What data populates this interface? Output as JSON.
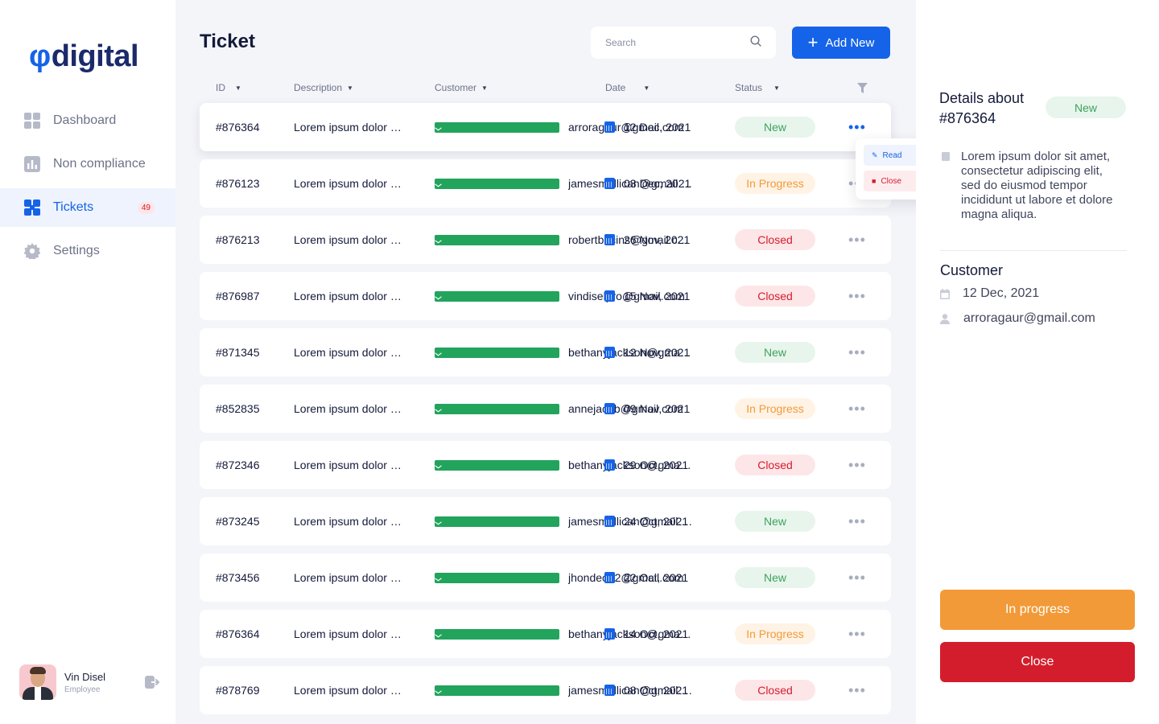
{
  "brand": {
    "mark": "φ",
    "name": "digital"
  },
  "nav": [
    {
      "label": "Dashboard",
      "icon": "dashboard-icon",
      "active": false,
      "badge": ""
    },
    {
      "label": "Non compliance",
      "icon": "chart-icon",
      "active": false,
      "badge": ""
    },
    {
      "label": "Tickets",
      "icon": "tickets-icon",
      "active": true,
      "badge": "49"
    },
    {
      "label": "Settings",
      "icon": "gear-icon",
      "active": false,
      "badge": ""
    }
  ],
  "user": {
    "name": "Vin Disel",
    "role": "Employee"
  },
  "page": {
    "title": "Ticket"
  },
  "search": {
    "placeholder": "Search"
  },
  "actions": {
    "add_label": "Add New"
  },
  "columns": {
    "id": "ID",
    "description": "Description",
    "customer": "Customer",
    "date": "Date",
    "status": "Status"
  },
  "status_colors": {
    "New": {
      "bg": "#e8f5ec",
      "fg": "#3ea35c"
    },
    "In Progress": {
      "bg": "#fff3e6",
      "fg": "#f29a38"
    },
    "Closed": {
      "bg": "#fde6e8",
      "fg": "#d61c2b"
    }
  },
  "tickets": [
    {
      "id": "#876364",
      "description": "Lorem ipsum dolor sit amet",
      "customer": "arroragaur@gmail.com",
      "date": "12 Dec, 2021",
      "status": "New"
    },
    {
      "id": "#876123",
      "description": "Lorem ipsum dolor sit amet",
      "customer": "jamesmullican@gmail.com",
      "date": "03 Dec, 2021",
      "status": "In Progress"
    },
    {
      "id": "#876213",
      "description": "Lorem ipsum dolor sit amet",
      "customer": "robertbacins@gmail.com",
      "date": "26 Nov, 2021",
      "status": "Closed"
    },
    {
      "id": "#876987",
      "description": "Lorem ipsum dolor sit amet",
      "customer": "vindiselpro@gmail.com",
      "date": "15 Nov, 2021",
      "status": "Closed"
    },
    {
      "id": "#871345",
      "description": "Lorem ipsum dolor sit amet",
      "customer": "bethanyjackson@gmail.com",
      "date": "12 Nov, 2021",
      "status": "New"
    },
    {
      "id": "#852835",
      "description": "Lorem ipsum dolor sit amet",
      "customer": "annejacob@gmail.com",
      "date": "09 Nov, 2021",
      "status": "In Progress"
    },
    {
      "id": "#872346",
      "description": "Lorem ipsum dolor sit amet",
      "customer": "bethanyjackson@gmail.com",
      "date": "29 Oct, 2021",
      "status": "Closed"
    },
    {
      "id": "#873245",
      "description": "Lorem ipsum dolor sit amet",
      "customer": "jamesmullican@gmail.com",
      "date": "24 Oct, 2021",
      "status": "New"
    },
    {
      "id": "#873456",
      "description": "Lorem ipsum dolor sit amet",
      "customer": "jhondeo32@gmail.com",
      "date": "22 Oct, 2021",
      "status": "New"
    },
    {
      "id": "#876364",
      "description": "Lorem ipsum dolor sit amet",
      "customer": "bethanyjackson@gmail.com",
      "date": "14 Oct, 2021",
      "status": "In Progress"
    },
    {
      "id": "#878769",
      "description": "Lorem ipsum dolor sit amet",
      "customer": "jamesmullican@gmail.com",
      "date": "08 Oct, 2021",
      "status": "Closed"
    }
  ],
  "row_menu": {
    "read_label": "Read",
    "close_label": "Close"
  },
  "details": {
    "heading": "Details about",
    "ticket_id": "#876364",
    "status": "New",
    "description": "Lorem ipsum dolor sit amet, consectetur adipiscing elit, sed do eiusmod tempor incididunt ut labore et dolore magna aliqua.",
    "customer_heading": "Customer",
    "date": "12 Dec, 2021",
    "email": "arroragaur@gmail.com",
    "progress_label": "In progress",
    "close_label": "Close"
  },
  "colors": {
    "accent": "#1563e8",
    "progress": "#f29a38",
    "danger": "#d41d2c",
    "success": "#22a45d"
  }
}
